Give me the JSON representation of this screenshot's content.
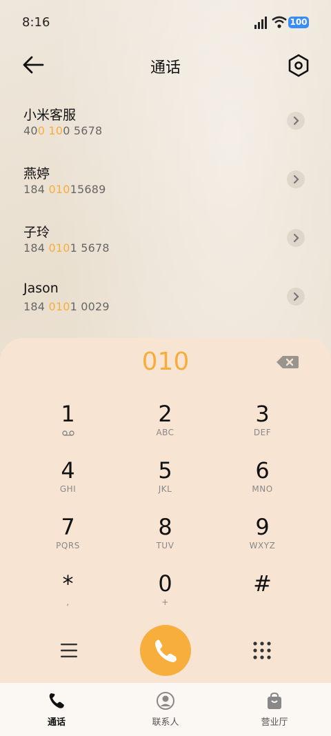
{
  "status_bar": {
    "time": "8:16",
    "battery": "100"
  },
  "header": {
    "title": "通话"
  },
  "contacts": [
    {
      "name": "小米客服",
      "number_parts": [
        "40",
        "0 10",
        "0 5678"
      ]
    },
    {
      "name": "燕婷",
      "number_parts": [
        "184 ",
        "010",
        "15689"
      ]
    },
    {
      "name": "子玲",
      "number_parts": [
        "184 ",
        "010",
        "1 5678"
      ]
    },
    {
      "name": "Jason",
      "number_parts": [
        "184 ",
        "010",
        "1 0029"
      ]
    }
  ],
  "dialpad": {
    "entered": "010",
    "keys": [
      {
        "num": "1",
        "letters": ""
      },
      {
        "num": "2",
        "letters": "ABC"
      },
      {
        "num": "3",
        "letters": "DEF"
      },
      {
        "num": "4",
        "letters": "GHI"
      },
      {
        "num": "5",
        "letters": "JKL"
      },
      {
        "num": "6",
        "letters": "MNO"
      },
      {
        "num": "7",
        "letters": "PQRS"
      },
      {
        "num": "8",
        "letters": "TUV"
      },
      {
        "num": "9",
        "letters": "WXYZ"
      },
      {
        "num": "*",
        "letters": ","
      },
      {
        "num": "0",
        "letters": "+"
      },
      {
        "num": "#",
        "letters": ""
      }
    ]
  },
  "tabs": [
    {
      "label": "通话",
      "icon": "phone-icon",
      "active": true
    },
    {
      "label": "联系人",
      "icon": "person-icon",
      "active": false
    },
    {
      "label": "营业厅",
      "icon": "shopping-bag-icon",
      "active": false
    }
  ],
  "colors": {
    "accent": "#f8ae3d",
    "pad_bg": "#f7e4d3",
    "battery": "#3a8df5"
  }
}
